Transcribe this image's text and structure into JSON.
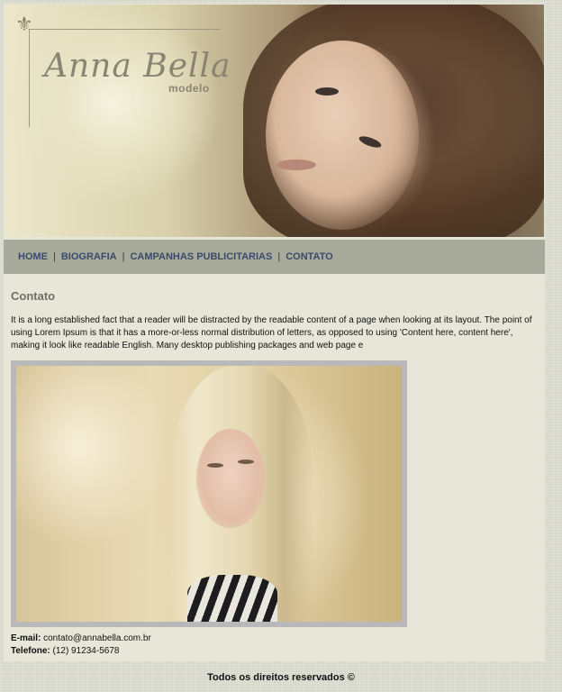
{
  "banner": {
    "brand_name": "Anna Bella",
    "brand_subtitle": "modelo",
    "ornament_icon": "fleur-de-lis-icon"
  },
  "nav": {
    "items": [
      {
        "label": "HOME"
      },
      {
        "label": "BIOGRAFIA"
      },
      {
        "label": "CAMPANHAS PUBLICITARIAS"
      },
      {
        "label": "CONTATO"
      }
    ],
    "separator": "|"
  },
  "content": {
    "title": "Contato",
    "paragraph": "It is a long established fact that a reader will be distracted by the readable content of a page when looking at its layout. The point of using Lorem Ipsum is that it has a more-or-less normal distribution of letters, as opposed to using 'Content here, content here', making it look like readable English. Many desktop publishing packages and web page e"
  },
  "contact": {
    "email_label": "E-mail:",
    "email_value": "contato@annabella.com.br",
    "phone_label": "Telefone:",
    "phone_value": "(12) 91234-5678"
  },
  "footer": {
    "text": "Todos os direitos reservados ©"
  },
  "colors": {
    "background": "#d6d7c9",
    "page": "#e6e7d9",
    "navbar": "#a8aa9b",
    "nav_link": "#3a4a6a",
    "title": "#6f6f66"
  }
}
